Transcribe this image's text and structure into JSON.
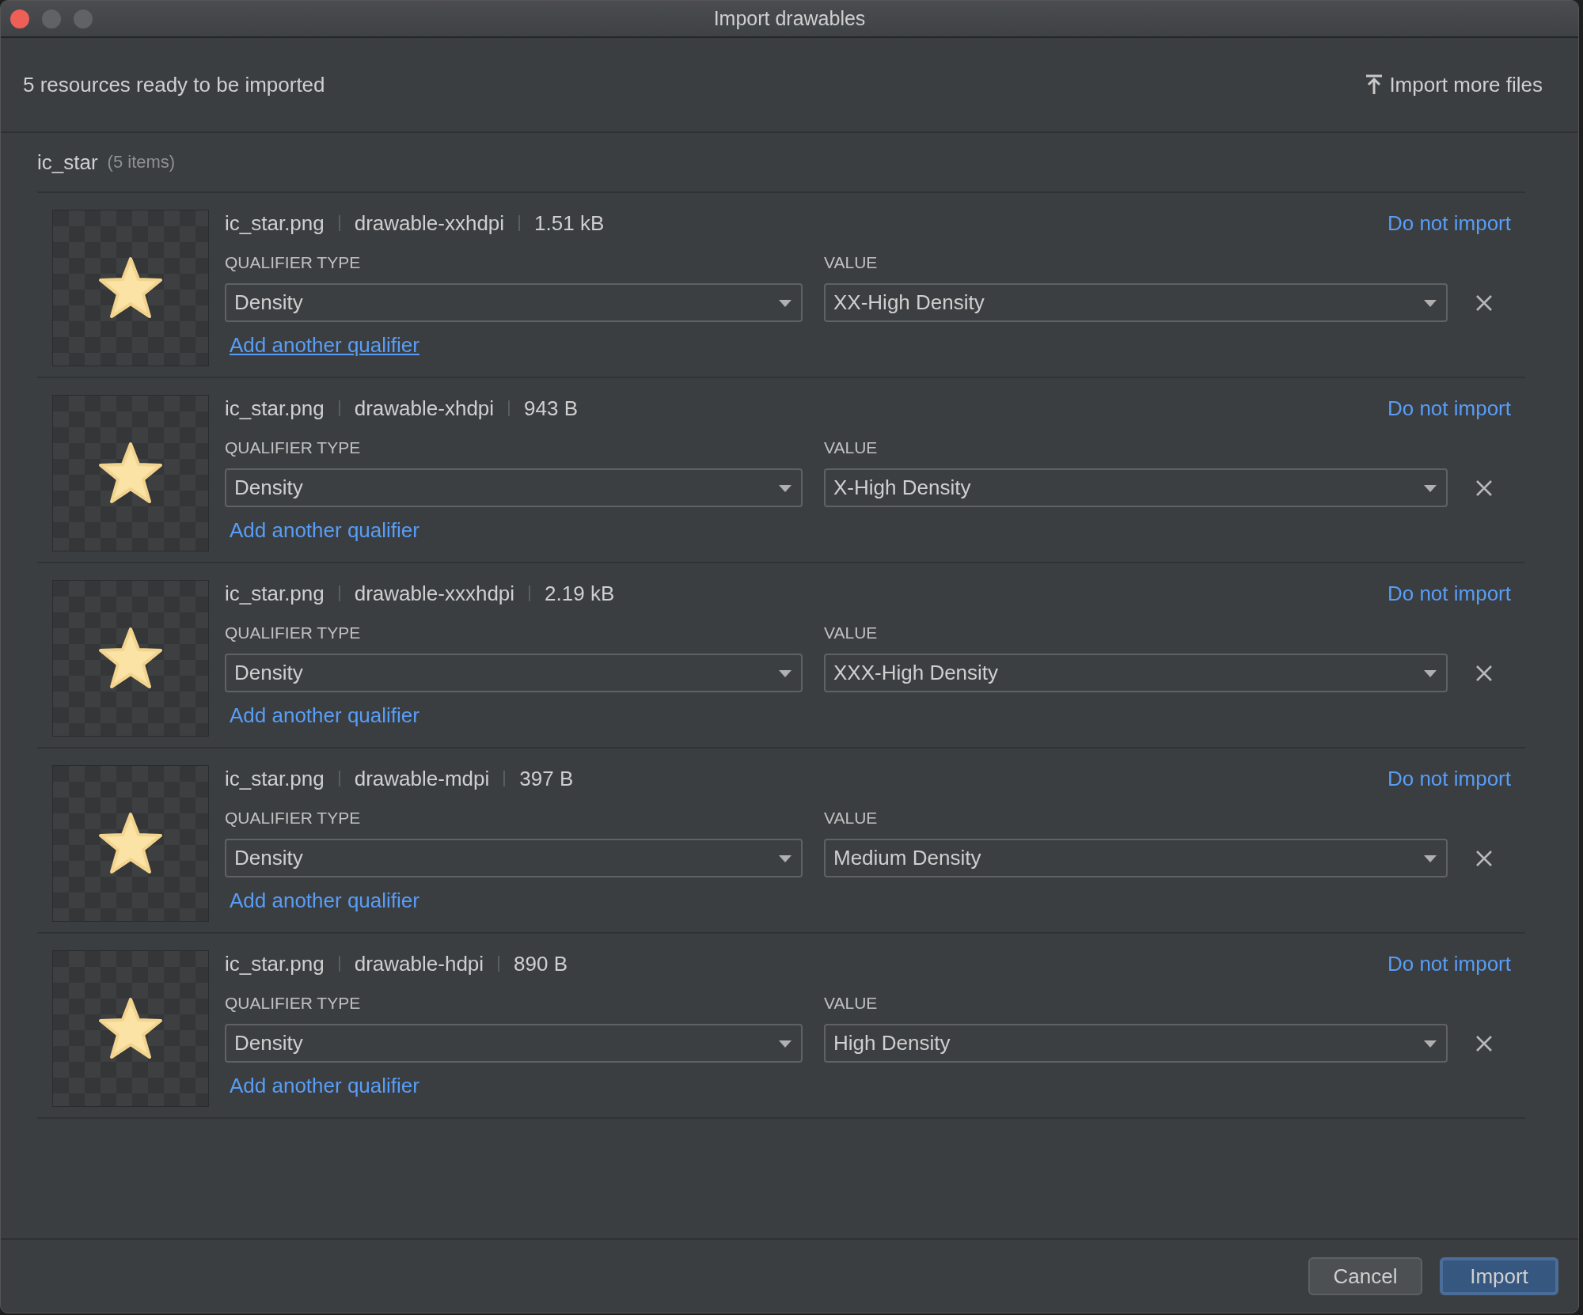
{
  "window": {
    "title": "Import drawables"
  },
  "header": {
    "summary": "5 resources ready to be imported",
    "import_more": "Import more files"
  },
  "group": {
    "name": "ic_star",
    "count": "(5 items)"
  },
  "resources": [
    {
      "file": "ic_star.png",
      "folder": "drawable-xxhdpi",
      "size": "1.51 kB",
      "do_not_import": "Do not import",
      "qualifier_label": "QUALIFIER TYPE",
      "qualifier": "Density",
      "value_label": "VALUE",
      "value": "XX-High Density",
      "add_link": "Add another qualifier",
      "hovered": true
    },
    {
      "file": "ic_star.png",
      "folder": "drawable-xhdpi",
      "size": "943 B",
      "do_not_import": "Do not import",
      "qualifier_label": "QUALIFIER TYPE",
      "qualifier": "Density",
      "value_label": "VALUE",
      "value": "X-High Density",
      "add_link": "Add another qualifier",
      "hovered": false
    },
    {
      "file": "ic_star.png",
      "folder": "drawable-xxxhdpi",
      "size": "2.19 kB",
      "do_not_import": "Do not import",
      "qualifier_label": "QUALIFIER TYPE",
      "qualifier": "Density",
      "value_label": "VALUE",
      "value": "XXX-High Density",
      "add_link": "Add another qualifier",
      "hovered": false
    },
    {
      "file": "ic_star.png",
      "folder": "drawable-mdpi",
      "size": "397 B",
      "do_not_import": "Do not import",
      "qualifier_label": "QUALIFIER TYPE",
      "qualifier": "Density",
      "value_label": "VALUE",
      "value": "Medium Density",
      "add_link": "Add another qualifier",
      "hovered": false
    },
    {
      "file": "ic_star.png",
      "folder": "drawable-hdpi",
      "size": "890 B",
      "do_not_import": "Do not import",
      "qualifier_label": "QUALIFIER TYPE",
      "qualifier": "Density",
      "value_label": "VALUE",
      "value": "High Density",
      "add_link": "Add another qualifier",
      "hovered": false
    }
  ],
  "buttons": [
    {
      "label": "Cancel",
      "kind": "secondary"
    },
    {
      "label": "Import",
      "kind": "primary"
    }
  ]
}
